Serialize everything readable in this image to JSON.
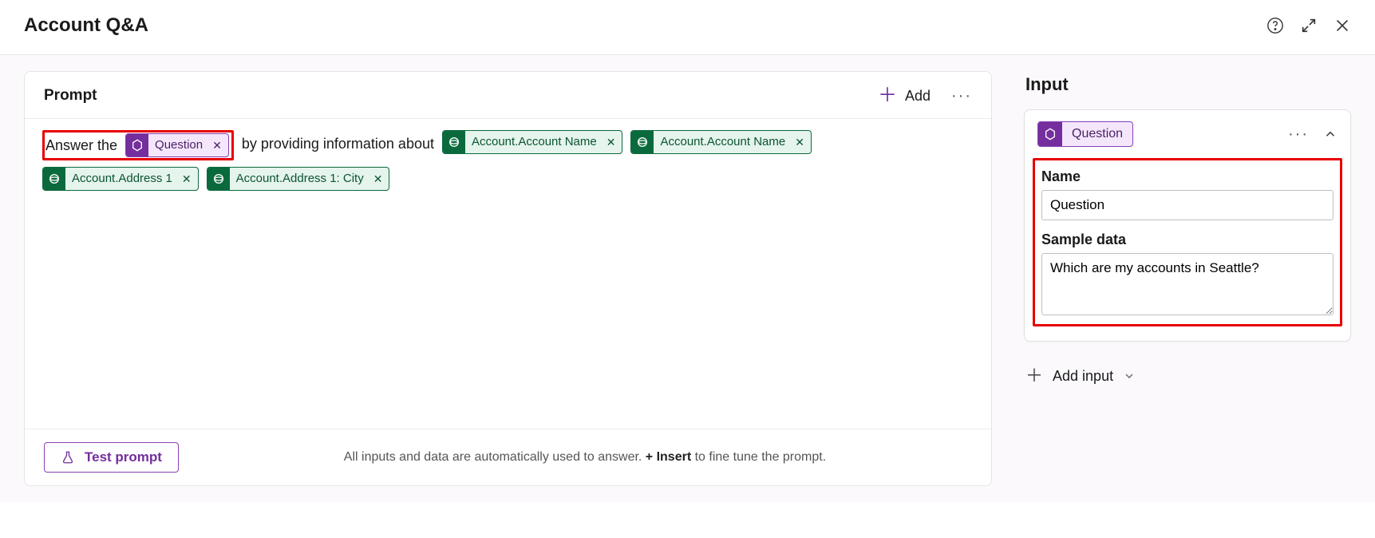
{
  "header": {
    "title": "Account Q&A"
  },
  "prompt": {
    "panel_title": "Prompt",
    "add_label": "Add",
    "text_before": "Answer the",
    "question_token": "Question",
    "text_mid": "by providing information about",
    "data_tokens": [
      "Account.Account Name",
      "Account.Account Name",
      "Account.Address 1",
      "Account.Address 1: City"
    ],
    "footer_text_pre": "All inputs and data are automatically used to answer. ",
    "footer_insert": "+ Insert",
    "footer_text_post": " to fine tune the prompt.",
    "test_label": "Test prompt"
  },
  "input": {
    "panel_title": "Input",
    "chip_label": "Question",
    "name_label": "Name",
    "name_value": "Question",
    "sample_label": "Sample data",
    "sample_value": "Which are my accounts in Seattle?",
    "add_input_label": "Add input"
  }
}
